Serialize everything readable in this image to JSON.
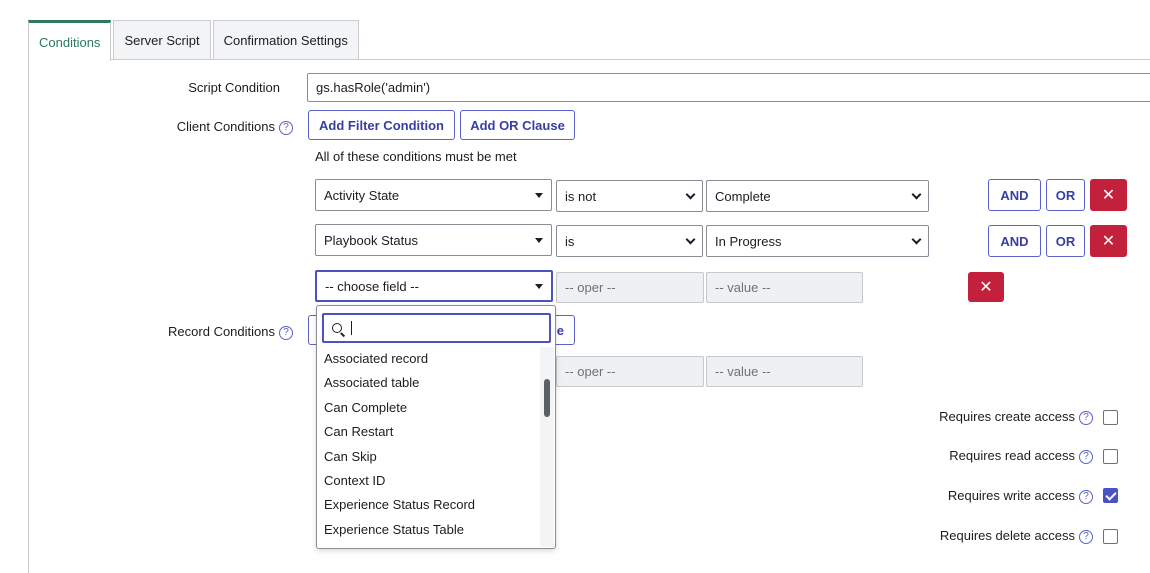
{
  "tabs": [
    {
      "label": "Conditions"
    },
    {
      "label": "Server Script"
    },
    {
      "label": "Confirmation Settings"
    }
  ],
  "script_condition": {
    "label": "Script Condition",
    "value": "gs.hasRole('admin')"
  },
  "client_conditions": {
    "label": "Client Conditions",
    "add_filter_label": "Add Filter Condition",
    "add_or_label": "Add OR Clause",
    "note": "All of these conditions must be met",
    "rows": [
      {
        "field": "Activity State",
        "operator": "is not",
        "value": "Complete"
      },
      {
        "field": "Playbook Status",
        "operator": "is",
        "value": "In Progress"
      }
    ],
    "new_row": {
      "field": "-- choose field --",
      "operator": "-- oper --",
      "value": "-- value --"
    }
  },
  "record_conditions": {
    "label": "Record Conditions",
    "hidden_button_fragment": "e",
    "operator": "-- oper --",
    "value": "-- value --"
  },
  "buttons": {
    "and_label": "AND",
    "or_label": "OR",
    "remove_symbol": "✕"
  },
  "help_symbol": "?",
  "field_picker": {
    "search_value": "",
    "items": [
      "Associated record",
      "Associated table",
      "Can Complete",
      "Can Restart",
      "Can Skip",
      "Context ID",
      "Experience Status Record",
      "Experience Status Table"
    ]
  },
  "access": [
    {
      "label": "Requires create access",
      "checked": false
    },
    {
      "label": "Requires read access",
      "checked": false
    },
    {
      "label": "Requires write access",
      "checked": true
    },
    {
      "label": "Requires delete access",
      "checked": false
    }
  ],
  "colors": {
    "accent": "#4b52c1",
    "tab_active": "#2c7a5b",
    "danger": "#c3203b"
  }
}
